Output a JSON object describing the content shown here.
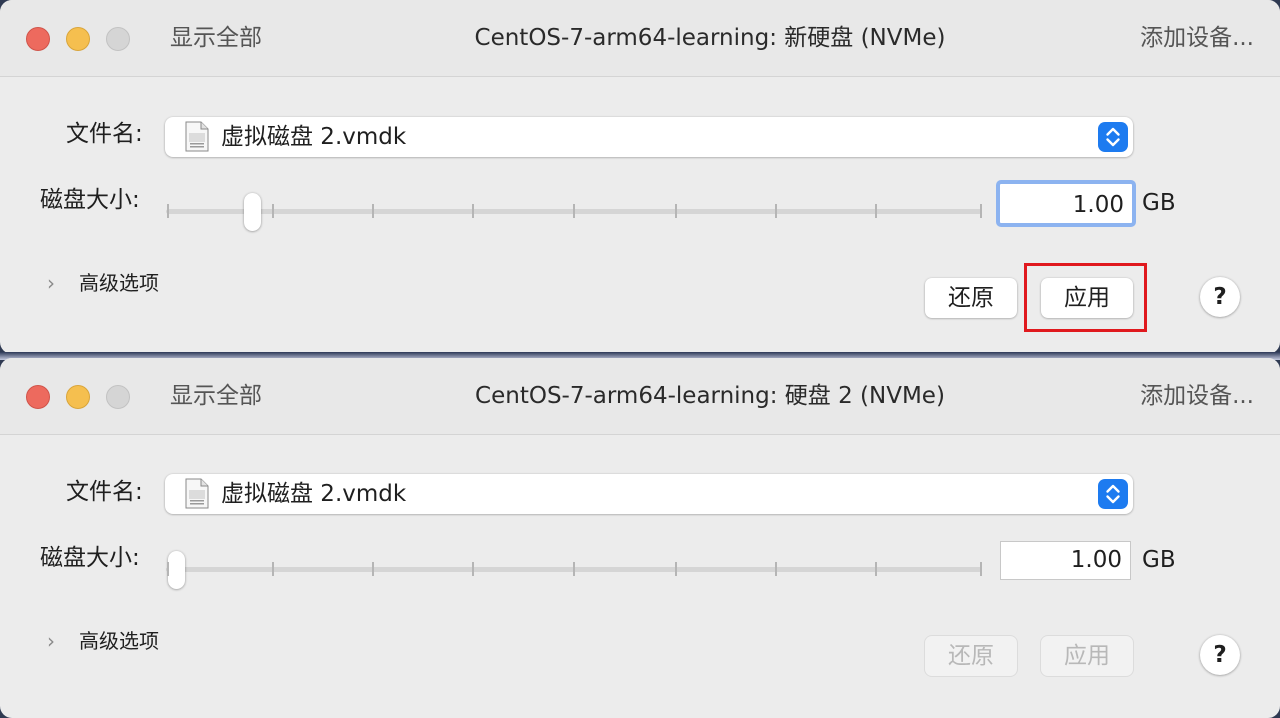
{
  "windows": [
    {
      "show_all": "显示全部",
      "title": "CentOS-7-arm64-learning: 新硬盘 (NVMe)",
      "add_device": "添加设备...",
      "filename_label": "文件名:",
      "filename_value": "虚拟磁盘 2.vmdk",
      "disk_size_label": "磁盘大小:",
      "disk_size_value": "1.00",
      "disk_size_unit": "GB",
      "slider_level": 0.11,
      "advanced_label": "高级选项",
      "revert_label": "还原",
      "apply_label": "应用",
      "help_label": "?",
      "buttons_enabled": true,
      "apply_highlighted": true
    },
    {
      "show_all": "显示全部",
      "title": "CentOS-7-arm64-learning: 硬盘 2 (NVMe)",
      "add_device": "添加设备...",
      "filename_label": "文件名:",
      "filename_value": "虚拟磁盘 2.vmdk",
      "disk_size_label": "磁盘大小:",
      "disk_size_value": "1.00",
      "disk_size_unit": "GB",
      "slider_level": 0.0,
      "advanced_label": "高级选项",
      "revert_label": "还原",
      "apply_label": "应用",
      "help_label": "?",
      "buttons_enabled": false,
      "apply_highlighted": false
    }
  ],
  "icons": {
    "close": "red-close-icon",
    "minimize": "yellow-minimize-icon",
    "zoom": "gray-zoom-icon",
    "file": "vmdk-file-icon",
    "popup": "popup-stepper-icon",
    "disclosure": "chevron-right-icon"
  },
  "colors": {
    "accent": "#1d7bf0",
    "focus_ring": "#8cb3f0",
    "highlight_box": "#e0191e",
    "close": "#ed6a5e",
    "minimize": "#f5bf4f",
    "zoom_inactive": "#d5d5d5"
  }
}
